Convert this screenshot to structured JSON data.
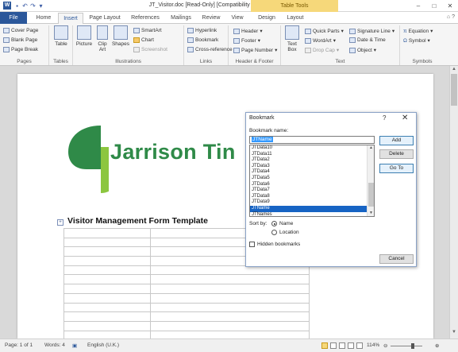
{
  "window": {
    "title": "JT_Visitor.doc [Read-Only] [Compatibility Mode] - Microsoft Word",
    "table_tools": "Table Tools",
    "qat_icons": [
      "save-icon",
      "undo-icon",
      "redo-icon",
      "customize-icon"
    ]
  },
  "tabs": [
    "File",
    "Home",
    "Insert",
    "Page Layout",
    "References",
    "Mailings",
    "Review",
    "View",
    "Design",
    "Layout"
  ],
  "active_tab": "Insert",
  "ribbon": {
    "pages": {
      "label": "Pages",
      "items": [
        "Cover Page",
        "Blank Page",
        "Page Break"
      ]
    },
    "tables": {
      "label": "Tables",
      "button": "Table"
    },
    "illustrations": {
      "label": "Illustrations",
      "picture": "Picture",
      "clipart_1": "Clip",
      "clipart_2": "Art",
      "shapes": "Shapes",
      "smartart": "SmartArt",
      "chart": "Chart",
      "screenshot": "Screenshot"
    },
    "links": {
      "label": "Links",
      "items": [
        "Hyperlink",
        "Bookmark",
        "Cross-reference"
      ]
    },
    "header_footer": {
      "label": "Header & Footer",
      "items": [
        "Header",
        "Footer",
        "Page Number"
      ]
    },
    "text": {
      "label": "Text",
      "textbox_1": "Text",
      "textbox_2": "Box",
      "items": [
        "Quick Parts",
        "WordArt",
        "Drop Cap",
        "Signature Line",
        "Date & Time",
        "Object"
      ]
    },
    "symbols": {
      "label": "Symbols",
      "items": [
        "Equation",
        "Symbol"
      ]
    }
  },
  "document": {
    "logo_text": "Jarrison Tin",
    "form_title": "Visitor Management Form Template",
    "logo_colors": {
      "dark": "#2f8a48",
      "light": "#8cc63f"
    },
    "table_rows": 13
  },
  "dialog": {
    "title": "Bookmark",
    "help": "?",
    "close": "✕",
    "name_label": "Bookmark name:",
    "name_value": "JTName",
    "list": [
      "JTData10",
      "JTData11",
      "JTData2",
      "JTData3",
      "JTData4",
      "JTData5",
      "JTData6",
      "JTData7",
      "JTData8",
      "JTData9",
      "JTName",
      "JTNames"
    ],
    "selected_index": 10,
    "buttons": {
      "add": "Add",
      "delete": "Delete",
      "goto": "Go To",
      "cancel": "Cancel"
    },
    "sort_by": "Sort by:",
    "sort_name": "Name",
    "sort_location": "Location",
    "hidden": "Hidden bookmarks"
  },
  "status": {
    "page": "Page: 1 of 1",
    "words": "Words: 4",
    "language": "English (U.K.)",
    "zoom": "114%"
  }
}
